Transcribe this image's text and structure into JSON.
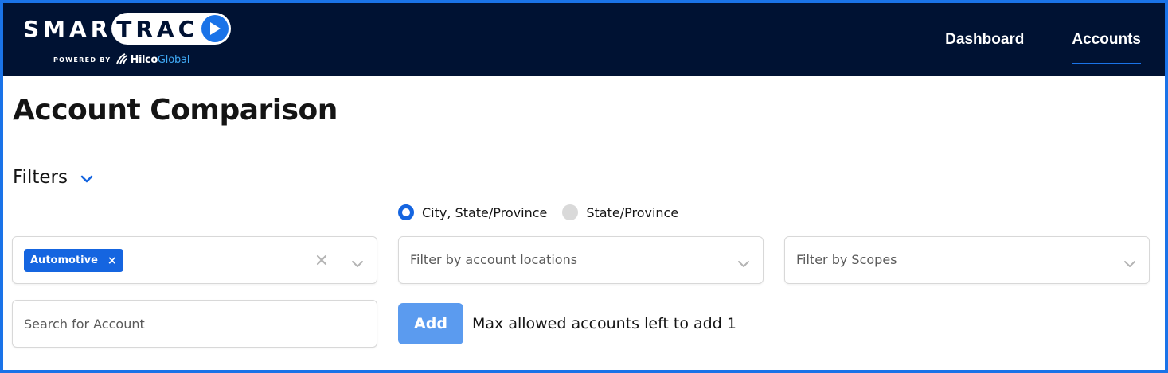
{
  "brand": {
    "logo_part1": "SMAR",
    "logo_part2": "TRAC",
    "powered_by": "POWERED BY",
    "partner_name_bold": "Hilco",
    "partner_name_light": "Global",
    "header_color": "#001233",
    "accent_color": "#1a73e8"
  },
  "nav": {
    "items": [
      {
        "label": "Dashboard",
        "active": false
      },
      {
        "label": "Accounts",
        "active": true
      }
    ]
  },
  "page": {
    "title": "Account Comparison"
  },
  "filters": {
    "toggle_label": "Filters",
    "toggle_icon": "chevron-down-icon",
    "location_mode": {
      "options": [
        {
          "label": "City, State/Province",
          "selected": true
        },
        {
          "label": "State/Province",
          "selected": false
        }
      ]
    },
    "industry": {
      "selected_chips": [
        {
          "label": "Automotive",
          "remove_glyph": "×"
        }
      ],
      "clear_icon": "close-icon",
      "dropdown_icon": "chevron-down-icon"
    },
    "locations": {
      "placeholder": "Filter by account locations",
      "dropdown_icon": "chevron-down-icon"
    },
    "scopes": {
      "placeholder": "Filter by Scopes",
      "dropdown_icon": "chevron-down-icon"
    },
    "account_search": {
      "placeholder": "Search for Account",
      "value": ""
    }
  },
  "add_account": {
    "button_label": "Add",
    "button_color": "#5b9bef",
    "limit_text": "Max allowed accounts left to add 1"
  }
}
